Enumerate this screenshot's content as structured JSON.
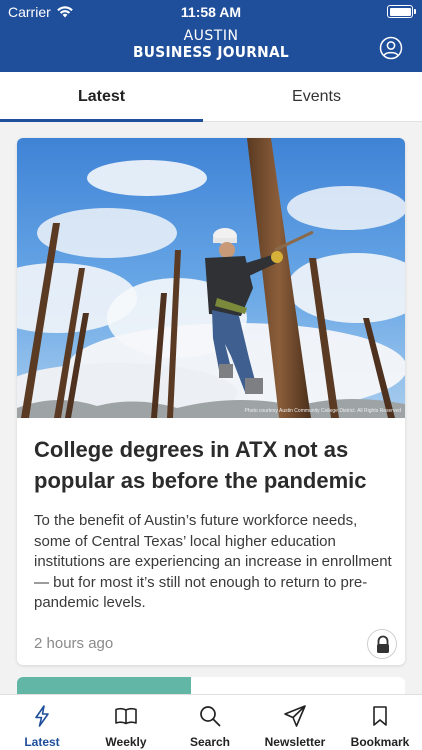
{
  "status_bar": {
    "carrier": "Carrier",
    "time": "11:58 AM",
    "wifi_icon": "wifi-icon",
    "battery_icon": "battery-icon"
  },
  "header": {
    "logo_top": "AUSTIN",
    "logo_bottom": "BUSINESS JOURNAL",
    "account_icon": "account-icon",
    "background_color": "#1f4e9a"
  },
  "tabs": [
    {
      "label": "Latest",
      "selected": true
    },
    {
      "label": "Events",
      "selected": false
    }
  ],
  "article": {
    "image_credit": "Photo courtesy Austin Community College District. All Rights Reserved",
    "headline": "College degrees in ATX not as popular as before the pandemic",
    "summary": "To the benefit of Austin’s future workforce needs, some of Central Texas’ local higher education institutions are experiencing an increase in enrollment — but for most it’s still not enough to return to pre-pandemic levels.",
    "timestamp": "2 hours ago",
    "lock_icon": "lock-icon"
  },
  "bottom_nav": [
    {
      "label": "Latest",
      "icon": "lightning-icon",
      "active": true
    },
    {
      "label": "Weekly",
      "icon": "book-icon",
      "active": false
    },
    {
      "label": "Search",
      "icon": "search-icon",
      "active": false
    },
    {
      "label": "Newsletter",
      "icon": "paper-plane-icon",
      "active": false
    },
    {
      "label": "Bookmark",
      "icon": "bookmark-icon",
      "active": false
    }
  ],
  "colors": {
    "brand_blue": "#1f4e9a",
    "next_card_accent": "#62b6a6"
  }
}
